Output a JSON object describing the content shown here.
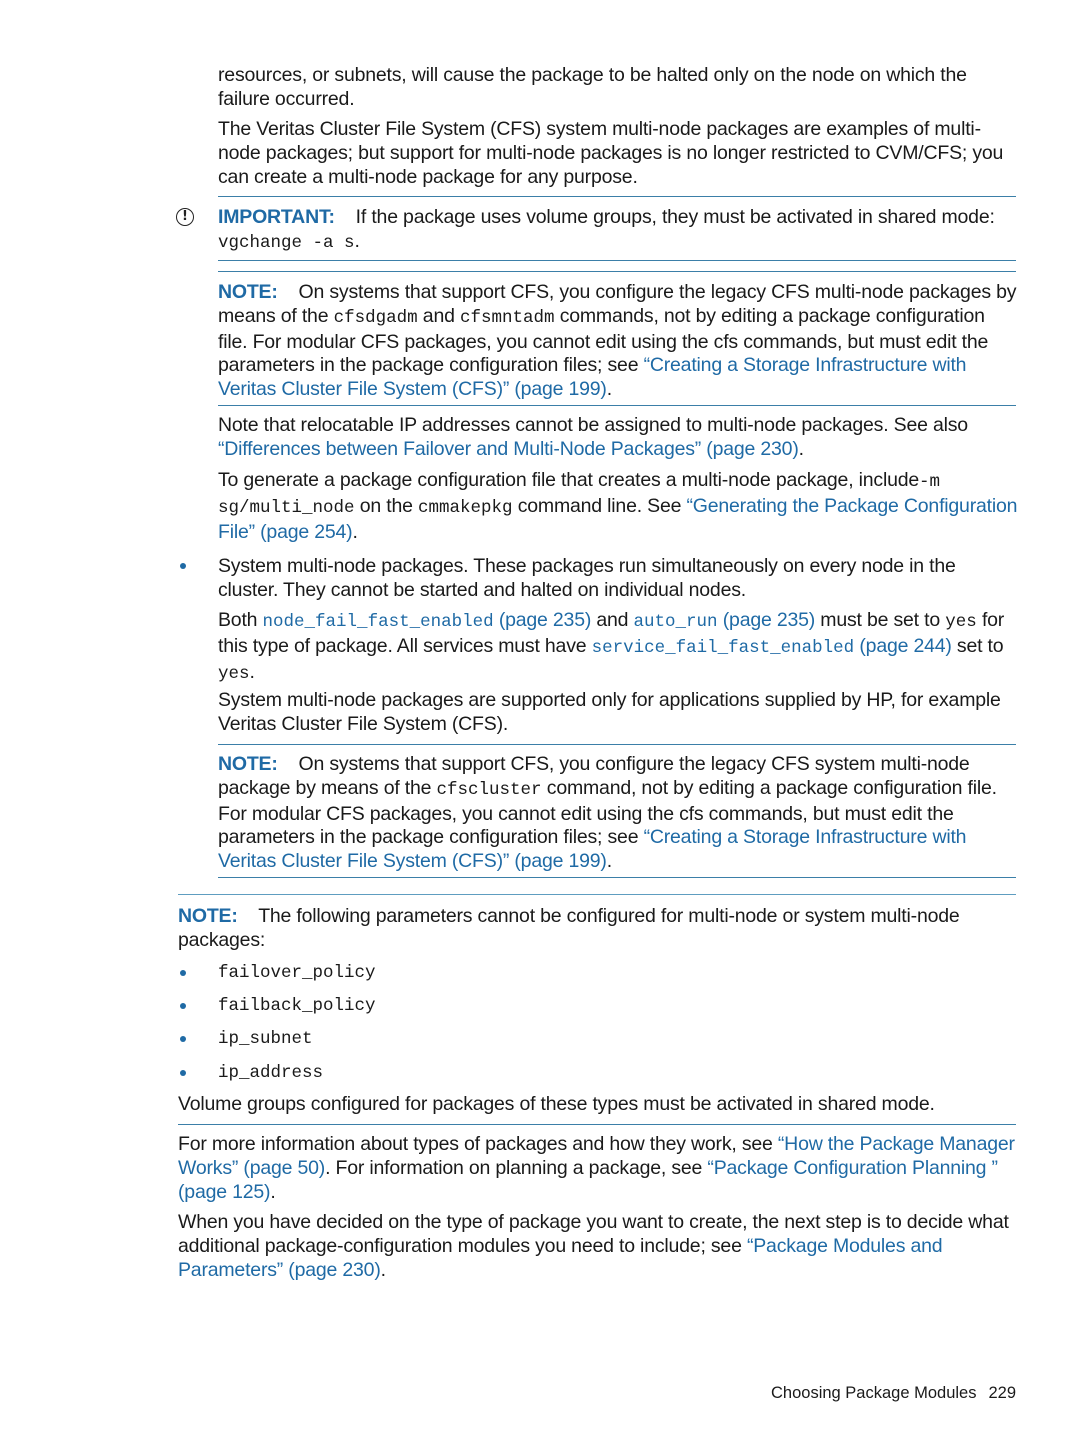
{
  "intro": {
    "p1": "resources, or subnets, will cause the package to be halted only on the node on which the failure occurred.",
    "p2": "The Veritas Cluster File System (CFS) system multi-node packages are examples of multi-node packages; but support for multi-node packages is no longer restricted to CVM/CFS; you can create a multi-node package for any purpose."
  },
  "important": {
    "icon": "exclamation-circle-icon",
    "label": "IMPORTANT:",
    "text": "If the package uses volume groups, they must be activated in shared mode:",
    "command": "vgchange -a s",
    "end": "."
  },
  "note1": {
    "label": "NOTE:",
    "t1": "On systems that support CFS, you configure the legacy CFS multi-node packages by means of the",
    "cmd1": "cfsdgadm",
    "t2": "and",
    "cmd2": "cfsmntadm",
    "t3": "commands, not by editing a package configuration file. For modular CFS packages, you cannot edit using the cfs commands, but must edit the parameters in the package configuration files; see",
    "link": "“Creating a Storage Infrastructure with Veritas Cluster File System (CFS)” (page 199)",
    "end": "."
  },
  "multinode": {
    "p1_text": "Note that relocatable IP addresses cannot be assigned to multi-node packages. See also",
    "p1_link": "“Differences between Failover and Multi-Node Packages” (page 230)",
    "p1_end": ".",
    "p2_t1": "To generate a package configuration file that creates a multi-node package, include",
    "p2_cmd1": "-m sg/multi_node",
    "p2_t2": "on the",
    "p2_cmd2": "cmmakepkg",
    "p2_t3": "command line. See",
    "p2_link": "“Generating the Package Configuration File” (page 254)",
    "p2_end": "."
  },
  "system_multinode": {
    "bullet_text": "System multi-node packages. These packages run simultaneously on every node in the cluster. They cannot be started and halted on individual nodes.",
    "p1_t1": "Both",
    "p1_param1": "node_fail_fast_enabled",
    "p1_ref1": "(page 235)",
    "p1_t2": "and",
    "p1_param2": "auto_run",
    "p1_ref2": "(page 235)",
    "p1_t3": "must be set to",
    "p1_val1": "yes",
    "p1_t4": "for this type of package. All services must have",
    "p1_param3": "service_fail_fast_enabled",
    "p1_ref3": "(page 244)",
    "p1_t5": "set to",
    "p1_val2": "yes",
    "p1_end": ".",
    "p2": "System multi-node packages are supported only for applications supplied by HP, for example Veritas Cluster File System (CFS)."
  },
  "note2": {
    "label": "NOTE:",
    "t1": "On systems that support CFS, you configure the legacy CFS system multi-node package by means of the",
    "cmd": "cfscluster",
    "t2": "command, not by editing a package configuration file. For modular CFS packages, you cannot edit using the cfs commands, but must edit the parameters in the package configuration files; see",
    "link": "“Creating a Storage Infrastructure with Veritas Cluster File System (CFS)” (page 199)",
    "end": "."
  },
  "note3": {
    "label": "NOTE:",
    "text": "The following parameters cannot be configured for multi-node or system multi-node packages:",
    "params": [
      "failover_policy",
      "failback_policy",
      "ip_subnet",
      "ip_address"
    ],
    "after": "Volume groups configured for packages of these types must be activated in shared mode."
  },
  "closing": {
    "p1_t1": "For more information about types of packages and how they work, see",
    "p1_link1": "“How the Package Manager Works” (page 50)",
    "p1_t2": ". For information on planning a package, see",
    "p1_link2": "“Package Configuration Planning ” (page 125)",
    "p1_end": ".",
    "p2_t1": "When you have decided on the type of package you want to create, the next step is to decide what additional package-configuration modules you need to include; see",
    "p2_link": "“Package Modules and Parameters” (page 230)",
    "p2_end": "."
  },
  "footer": {
    "section": "Choosing Package Modules",
    "page_number": "229"
  },
  "colors": {
    "accent": "#1f6aa5",
    "rule": "#3b7fa8",
    "text": "#1a1a1a"
  }
}
